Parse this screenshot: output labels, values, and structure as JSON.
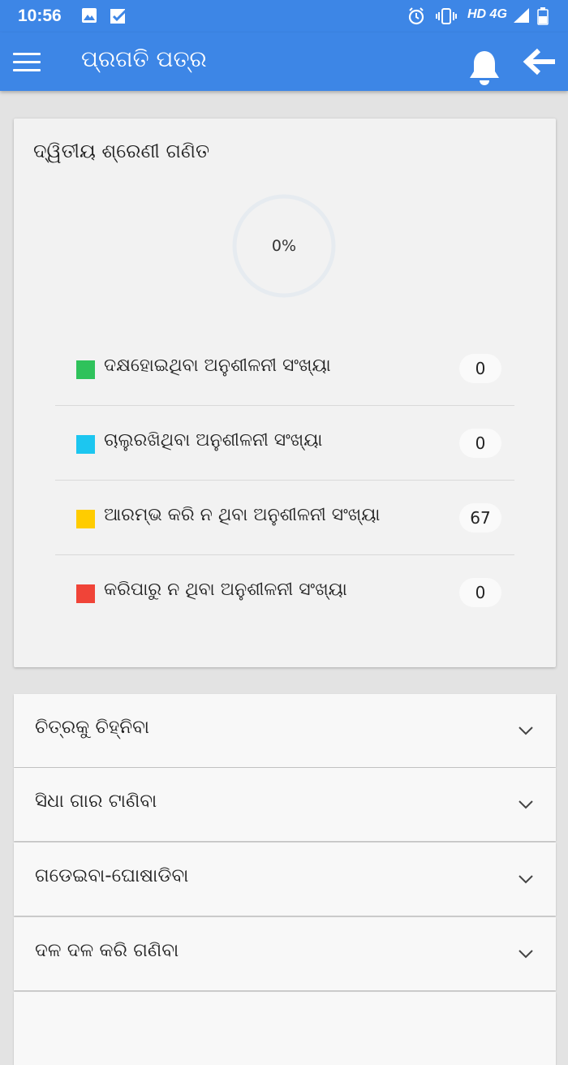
{
  "status_bar": {
    "time": "10:56",
    "network": "HD 4G"
  },
  "app_bar": {
    "title": "ପ୍ରଗତି ପତ୍ର",
    "icons": [
      "menu-icon",
      "bell-icon",
      "back-arrow-icon"
    ]
  },
  "progress_card": {
    "subject": "ଦ୍ୱିତୀୟ ଶ୍ରେଣୀ ଗଣିତ",
    "percent_text": "0%",
    "percent_value": 0,
    "stats": [
      {
        "label": "ଦକ୍ଷହୋଇଥିବା ଅନୁଶୀଳନୀ ସଂଖ୍ୟା",
        "count": "0",
        "color": "#2fc25b"
      },
      {
        "label": "ଚାଲୁରଖିଥିବା ଅନୁଶୀଳନୀ ସଂଖ୍ୟା",
        "count": "0",
        "color": "#1cc6f0"
      },
      {
        "label": "ଆରମ୍ଭ କରି ନ ଥିବା ଅନୁଶୀଳନୀ ସଂଖ୍ୟା",
        "count": "67",
        "color": "#ffcc00"
      },
      {
        "label": "କରିପାରୁ ନ ଥିବା ଅନୁଶୀଳନୀ ସଂଖ୍ୟା",
        "count": "0",
        "color": "#f04438"
      }
    ]
  },
  "topics": [
    {
      "label": "ଚିତ୍ରକୁ ଚିହ୍ନିବା"
    },
    {
      "label": "ସିଧା ଗାର ଟାଣିବା"
    },
    {
      "label": "ଗଡେଇବା-ଘୋଷାଡିବା"
    },
    {
      "label": "ଦଳ ଦଳ କରି ଗଣିବା"
    }
  ],
  "colors": {
    "primary": "#3d86e6",
    "background": "#e3e3e3",
    "card": "#f2f2f2"
  }
}
